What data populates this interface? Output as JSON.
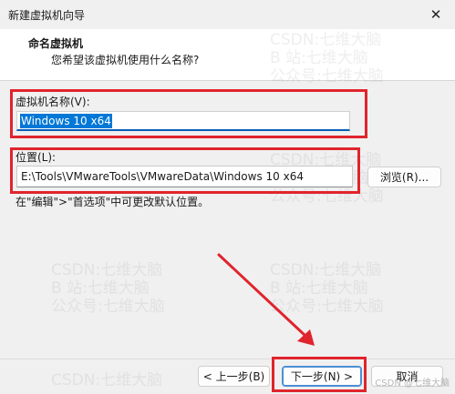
{
  "window": {
    "title": "新建虚拟机向导",
    "close_glyph": "✕"
  },
  "header": {
    "title": "命名虚拟机",
    "subtitle": "您希望该虚拟机使用什么名称?"
  },
  "name_field": {
    "label": "虚拟机名称(V):",
    "value": "Windows 10 x64"
  },
  "location_field": {
    "label": "位置(L):",
    "value": "E:\\Tools\\VMwareTools\\VMwareData\\Windows 10 x64",
    "browse_label": "浏览(R)..."
  },
  "hint": "在\"编辑\">\"首选项\"中可更改默认位置。",
  "buttons": {
    "back_label": "< 上一步(B)",
    "next_label": "下一步(N) >",
    "cancel_label": "取消"
  },
  "watermark": {
    "line1": "CSDN:七维大脑",
    "line2": "B 站:七维大脑",
    "line3": "公众号:七维大脑",
    "corner": "CSDN @七维大脑"
  },
  "annotation": {
    "color": "#e0242c"
  },
  "colors": {
    "accent": "#0078d7",
    "selection": "#0078d7",
    "background": "#f0f0f0"
  }
}
